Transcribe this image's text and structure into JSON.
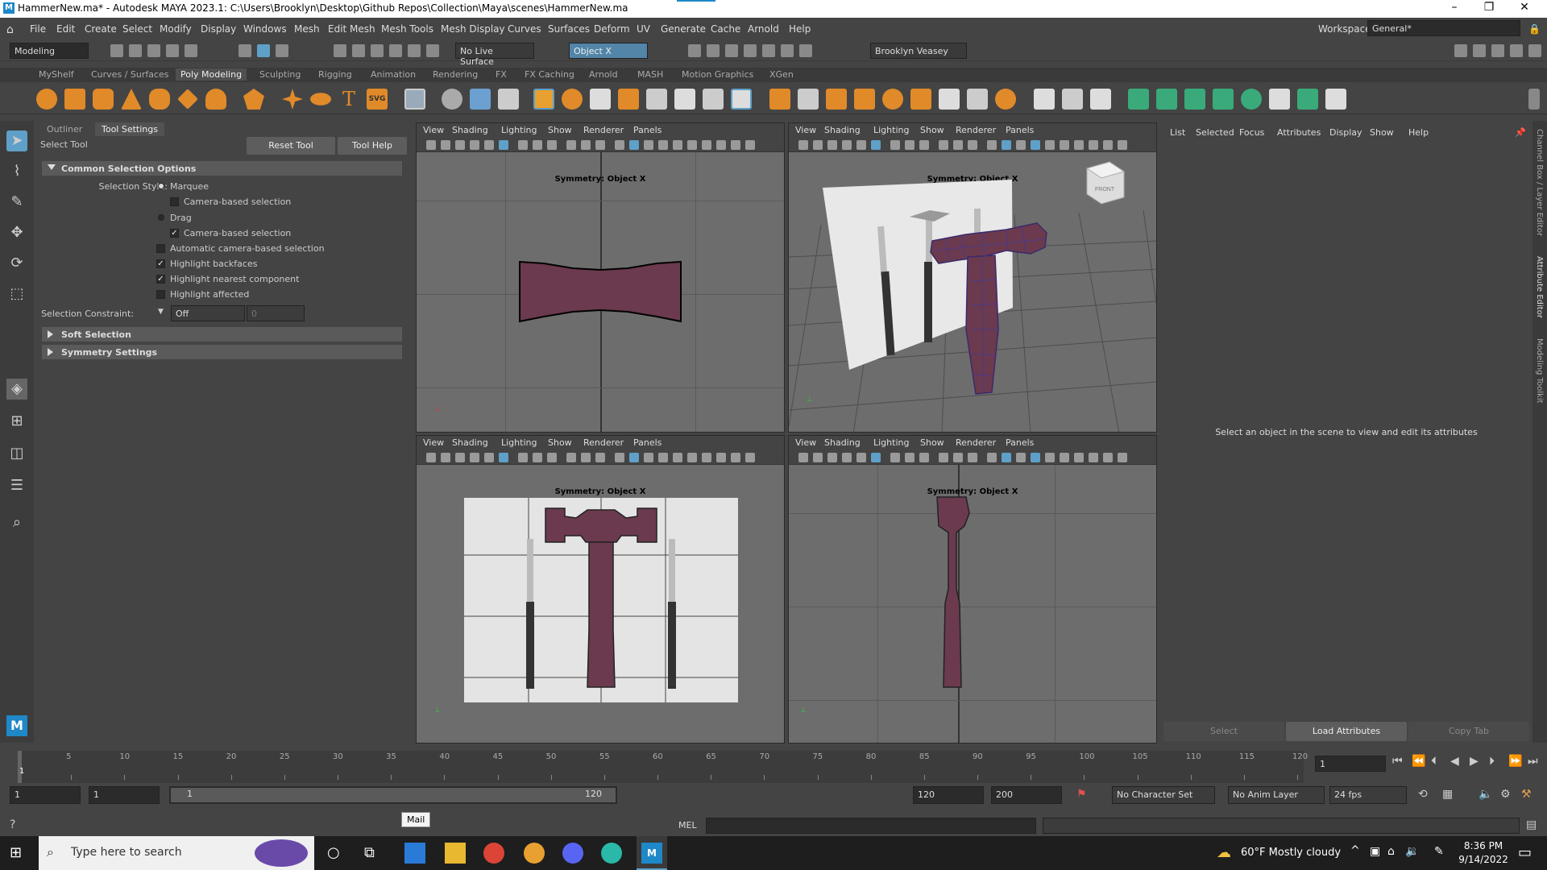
{
  "window": {
    "title": "HammerNew.ma* - Autodesk MAYA 2023.1: C:\\Users\\Brooklyn\\Desktop\\Github Repos\\Collection\\Maya\\scenes\\HammerNew.ma",
    "min": "–",
    "max": "❐",
    "close": "✕"
  },
  "menu": [
    "File",
    "Edit",
    "Create",
    "Select",
    "Modify",
    "Display",
    "Windows",
    "Mesh",
    "Edit Mesh",
    "Mesh Tools",
    "Mesh Display",
    "Curves",
    "Surfaces",
    "Deform",
    "UV",
    "Generate",
    "Cache",
    "Arnold",
    "Help"
  ],
  "workspace": {
    "label": "Workspace:",
    "value": "General*"
  },
  "statusline": {
    "mode": "Modeling",
    "live_surface": "No Live Surface",
    "symmetry": "Object X",
    "user": "Brooklyn Veasey"
  },
  "shelf_tabs": [
    "MyShelf",
    "Curves / Surfaces",
    "Poly Modeling",
    "Sculpting",
    "Rigging",
    "Animation",
    "Rendering",
    "FX",
    "FX Caching",
    "Arnold",
    "MASH",
    "Motion Graphics",
    "XGen"
  ],
  "shelf_active": "Poly Modeling",
  "tool_panel": {
    "tabs": [
      "Outliner",
      "Tool Settings"
    ],
    "tool_name": "Select Tool",
    "reset": "Reset Tool",
    "help": "Tool Help",
    "common_section": "Common Selection Options",
    "selection_style_label": "Selection Style:",
    "marquee": "Marquee",
    "camera_based1": "Camera-based selection",
    "drag": "Drag",
    "camera_based2": "Camera-based selection",
    "auto_camera": "Automatic camera-based selection",
    "highlight_backfaces": "Highlight backfaces",
    "highlight_nearest": "Highlight nearest component",
    "highlight_affected": "Highlight affected",
    "constraint_label": "Selection Constraint:",
    "constraint_value": "Off",
    "constraint_num": "0",
    "soft_selection": "Soft Selection",
    "symmetry_settings": "Symmetry Settings"
  },
  "viewport": {
    "menu": [
      "View",
      "Shading",
      "Lighting",
      "Show",
      "Renderer",
      "Panels"
    ],
    "symmetry": "Symmetry: Object X",
    "cube_label": "FRONT"
  },
  "attribute_editor": {
    "menu": [
      "List",
      "Selected",
      "Focus",
      "Attributes",
      "Display",
      "Show",
      "Help"
    ],
    "message": "Select an object in the scene to view and edit its attributes",
    "buttons": [
      "Select",
      "Load Attributes",
      "Copy Tab"
    ]
  },
  "side_tabs": [
    "Channel Box / Layer Editor",
    "Attribute Editor",
    "Modeling Toolkit"
  ],
  "timeline": {
    "ticks": [
      5,
      10,
      15,
      20,
      25,
      30,
      35,
      40,
      45,
      50,
      55,
      60,
      65,
      70,
      75,
      80,
      85,
      90,
      95,
      100,
      105,
      110,
      115,
      120
    ],
    "current": "1",
    "current_field": "1"
  },
  "range": {
    "start": "1",
    "start2": "1",
    "slider_start": "1",
    "slider_end": "120",
    "end": "120",
    "end2": "200",
    "character": "No Character Set",
    "anim_layer": "No Anim Layer",
    "fps": "24 fps"
  },
  "cmd": {
    "mel": "MEL",
    "tooltip": "Mail"
  },
  "taskbar": {
    "search": "Type here to search",
    "weather": "60°F  Mostly cloudy",
    "time": "8:36 PM",
    "date": "9/14/2022"
  },
  "colors": {
    "hammer": "#6b3a4e",
    "accent": "#5fa0c8",
    "viewport": "#6d6d6d"
  }
}
